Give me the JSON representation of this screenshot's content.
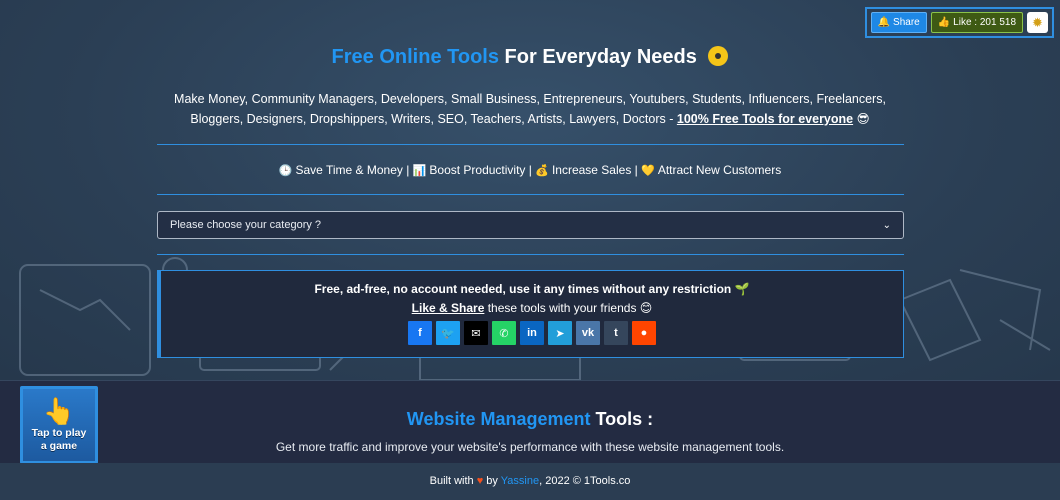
{
  "header_actions": {
    "share_label": "Share",
    "like_label": "Like : 201 518",
    "theme_icon": "sun-icon"
  },
  "hero": {
    "title_highlight": "Free Online Tools",
    "title_rest": "For Everyday Needs",
    "subtitle_line1": "Make Money, Community Managers, Developers, Small Business, Entrepreneurs, Youtubers, Students, Influencers, Freelancers,",
    "subtitle_line2": "Bloggers, Designers, Dropshippers, Writers, SEO, Teachers, Artists, Lawyers, Doctors - ",
    "subtitle_link": "100% Free Tools for everyone",
    "benefits": [
      {
        "icon": "clock-icon",
        "label": "Save Time & Money"
      },
      {
        "icon": "chart-icon",
        "label": "Boost Productivity"
      },
      {
        "icon": "money-bag-icon",
        "label": "Increase Sales"
      },
      {
        "icon": "heart-icon",
        "label": "Attract New Customers"
      }
    ],
    "category_placeholder": "Please choose your category ?"
  },
  "panel": {
    "line1": "Free, ad-free, no account needed, use it any times without any restriction",
    "like_share": "Like & Share",
    "line2_rest": " these tools with your friends",
    "social": [
      {
        "name": "facebook",
        "glyph": "f",
        "color": "#1877f2"
      },
      {
        "name": "twitter",
        "glyph": "t",
        "color": "#1da1f2"
      },
      {
        "name": "email",
        "glyph": "✉",
        "color": "#000000"
      },
      {
        "name": "whatsapp",
        "glyph": "w",
        "color": "#25d366"
      },
      {
        "name": "linkedin",
        "glyph": "in",
        "color": "#0a66c2"
      },
      {
        "name": "telegram",
        "glyph": "➤",
        "color": "#229ed9"
      },
      {
        "name": "vk",
        "glyph": "vk",
        "color": "#4a76a8"
      },
      {
        "name": "tumblr",
        "glyph": "t",
        "color": "#35465c"
      },
      {
        "name": "reddit",
        "glyph": "r",
        "color": "#ff4500"
      }
    ]
  },
  "game": {
    "label_line1": "Tap to play",
    "label_line2": "a game"
  },
  "section": {
    "title_highlight": "Website Management",
    "title_rest": " Tools :",
    "subtitle": "Get more traffic and improve your website's performance with these website management tools."
  },
  "footer": {
    "built_with": "Built with",
    "by": "by",
    "author": "Yassine",
    "rest": ", 2022 © 1Tools.co"
  },
  "colors": {
    "accent": "#2196f3",
    "background": "#2b3f55",
    "panel": "#20293d"
  }
}
